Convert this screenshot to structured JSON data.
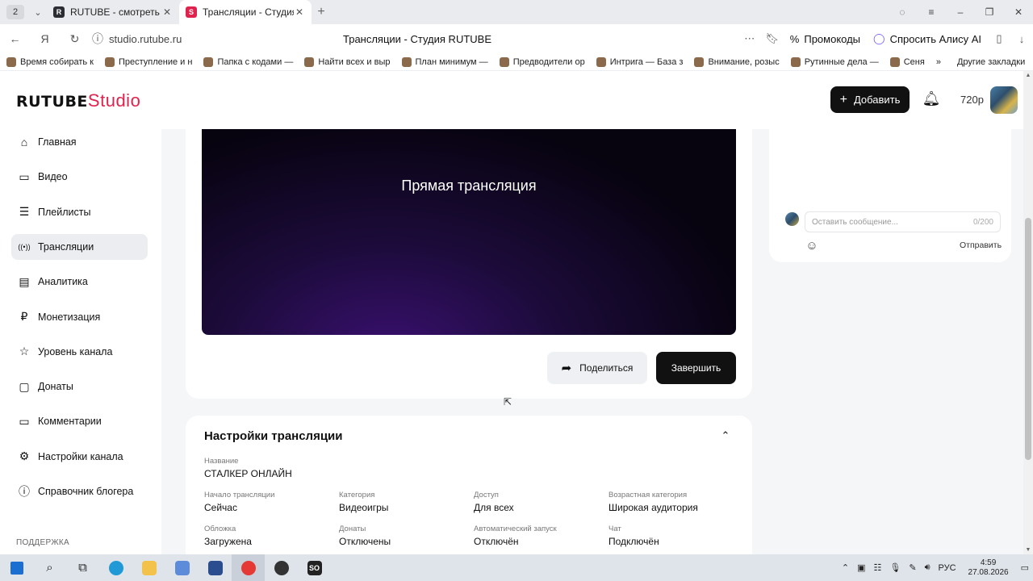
{
  "browser": {
    "tab_count": "2",
    "tabs": [
      {
        "label": "RUTUBE - смотреть виде",
        "icon": "rutube-icon",
        "active": false
      },
      {
        "label": "Трансляции - Студия R",
        "icon": "rutube-studio-icon",
        "active": true
      }
    ],
    "url": "studio.rutube.ru",
    "page_title": "Трансляции - Студия RUTUBE",
    "promo_label": "Промокоды",
    "alice_label": "Спросить Алису AI",
    "bookmarks": [
      "Время собирать к",
      "Преступление и н",
      "Папка с кодами —",
      "Найти всех и выр",
      "План минимум —",
      "Предводители ор",
      "Интрига — База з",
      "Внимание, розыс",
      "Рутинные дела —",
      "Сеня"
    ],
    "other_bookmarks": "Другие закладки"
  },
  "header": {
    "logo_main": "RUTUBE",
    "logo_studio": "Studio",
    "add_label": "Добавить",
    "quality": "720p"
  },
  "sidebar": {
    "items": [
      {
        "label": "Главная",
        "icon": "home-icon"
      },
      {
        "label": "Видео",
        "icon": "video-icon"
      },
      {
        "label": "Плейлисты",
        "icon": "playlist-icon"
      },
      {
        "label": "Трансляции",
        "icon": "broadcast-icon"
      },
      {
        "label": "Аналитика",
        "icon": "analytics-icon"
      },
      {
        "label": "Монетизация",
        "icon": "ruble-icon"
      },
      {
        "label": "Уровень канала",
        "icon": "star-icon"
      },
      {
        "label": "Донаты",
        "icon": "wallet-icon"
      },
      {
        "label": "Комментарии",
        "icon": "comment-icon"
      },
      {
        "label": "Настройки канала",
        "icon": "gear-icon"
      },
      {
        "label": "Справочник блогера",
        "icon": "info-icon"
      }
    ],
    "support_label": "ПОДДЕРЖКА"
  },
  "player": {
    "title": "Прямая трансляция"
  },
  "actions": {
    "share_label": "Поделиться",
    "finish_label": "Завершить"
  },
  "settings": {
    "title": "Настройки трансляции",
    "name_label": "Название",
    "name_value": "СТАЛКЕР ОНЛАЙН",
    "fields": [
      {
        "label": "Начало трансляции",
        "value": "Сейчас"
      },
      {
        "label": "Категория",
        "value": "Видеоигры"
      },
      {
        "label": "Доступ",
        "value": "Для всех"
      },
      {
        "label": "Возрастная категория",
        "value": "Широкая аудитория"
      },
      {
        "label": "Обложка",
        "value": "Загружена"
      },
      {
        "label": "Донаты",
        "value": "Отключены"
      },
      {
        "label": "Автоматический запуск",
        "value": "Отключён"
      },
      {
        "label": "Чат",
        "value": "Подключён"
      }
    ]
  },
  "chat": {
    "placeholder": "Оставить сообщение...",
    "counter": "0/200",
    "send_label": "Отправить"
  },
  "taskbar": {
    "lang": "РУС",
    "time": "4:59",
    "date": "27.08.2026"
  },
  "colors": {
    "brand": "#e0234e",
    "dark_button": "#111111"
  }
}
